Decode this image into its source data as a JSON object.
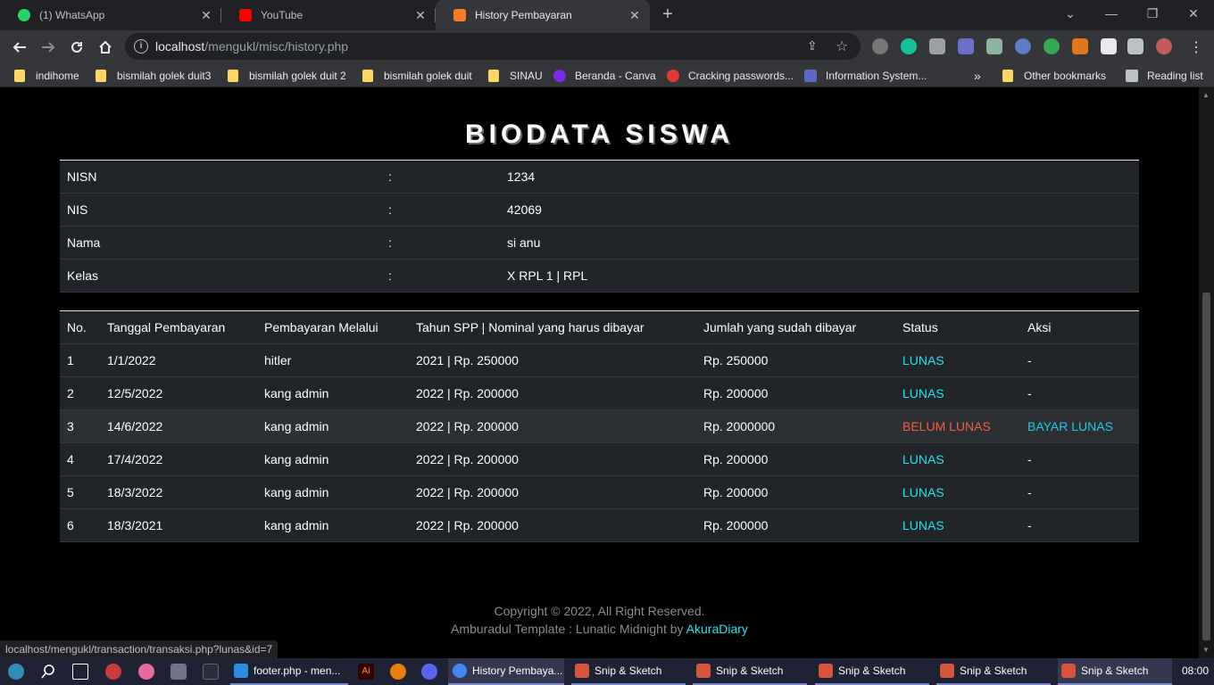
{
  "browser": {
    "tabs": [
      {
        "title": "(1) WhatsApp",
        "close": "✕"
      },
      {
        "title": "YouTube",
        "close": "✕"
      },
      {
        "title": "History Pembayaran",
        "close": "✕"
      }
    ],
    "new_tab": "+",
    "window_controls": [
      "⌄",
      "—",
      "❐",
      "✕"
    ],
    "url_host": "localhost",
    "url_path": "/mengukl/misc/history.php",
    "bookmarks": [
      "indihome",
      "bismilah golek duit3",
      "bismilah golek duit 2",
      "bismilah golek duit",
      "SINAU",
      "Beranda - Canva",
      "Cracking passwords...",
      "Information System..."
    ],
    "bookmarks_overflow": "»",
    "other_bookmarks": "Other bookmarks",
    "reading_list": "Reading list"
  },
  "page": {
    "heading": "BIODATA SISWA",
    "biodata": [
      {
        "label": "NISN",
        "sep": ":",
        "value": "1234"
      },
      {
        "label": "NIS",
        "sep": ":",
        "value": "42069"
      },
      {
        "label": "Nama",
        "sep": ":",
        "value": "si anu"
      },
      {
        "label": "Kelas",
        "sep": ":",
        "value": "X RPL 1 | RPL"
      }
    ],
    "history_headers": [
      "No.",
      "Tanggal Pembayaran",
      "Pembayaran Melalui",
      "Tahun SPP | Nominal yang harus dibayar",
      "Jumlah yang sudah dibayar",
      "Status",
      "Aksi"
    ],
    "history_rows": [
      {
        "no": "1",
        "date": "1/1/2022",
        "via": "hitler",
        "spp": "2021 | Rp. 250000",
        "paid": "Rp. 250000",
        "status": "LUNAS",
        "action": "-"
      },
      {
        "no": "2",
        "date": "12/5/2022",
        "via": "kang admin",
        "spp": "2022 | Rp. 200000",
        "paid": "Rp. 200000",
        "status": "LUNAS",
        "action": "-"
      },
      {
        "no": "3",
        "date": "14/6/2022",
        "via": "kang admin",
        "spp": "2022 | Rp. 200000",
        "paid": "Rp. 2000000",
        "status": "BELUM LUNAS",
        "action": "BAYAR LUNAS"
      },
      {
        "no": "4",
        "date": "17/4/2022",
        "via": "kang admin",
        "spp": "2022 | Rp. 200000",
        "paid": "Rp. 200000",
        "status": "LUNAS",
        "action": "-"
      },
      {
        "no": "5",
        "date": "18/3/2022",
        "via": "kang admin",
        "spp": "2022 | Rp. 200000",
        "paid": "Rp. 200000",
        "status": "LUNAS",
        "action": "-"
      },
      {
        "no": "6",
        "date": "18/3/2021",
        "via": "kang admin",
        "spp": "2022 | Rp. 200000",
        "paid": "Rp. 200000",
        "status": "LUNAS",
        "action": "-"
      }
    ],
    "footer_line1": "Copyright © 2022, All Right Reserved.",
    "footer_line2": "Amburadul Template : Lunatic Midnight by ",
    "footer_link": "AkuraDiary"
  },
  "status_url": "localhost/mengukl/transaction/transaksi.php?lunas&id=7",
  "taskbar": {
    "apps": [
      "footer.php - men...",
      "History Pembaya...",
      "Snip & Sketch",
      "Snip & Sketch",
      "Snip & Sketch",
      "Snip & Sketch",
      "Snip & Sketch"
    ],
    "clock": "08:00"
  },
  "colors": {
    "lunas": "#1fe6ee",
    "belum_lunas": "#f55d43",
    "link": "#1fcbe0"
  }
}
